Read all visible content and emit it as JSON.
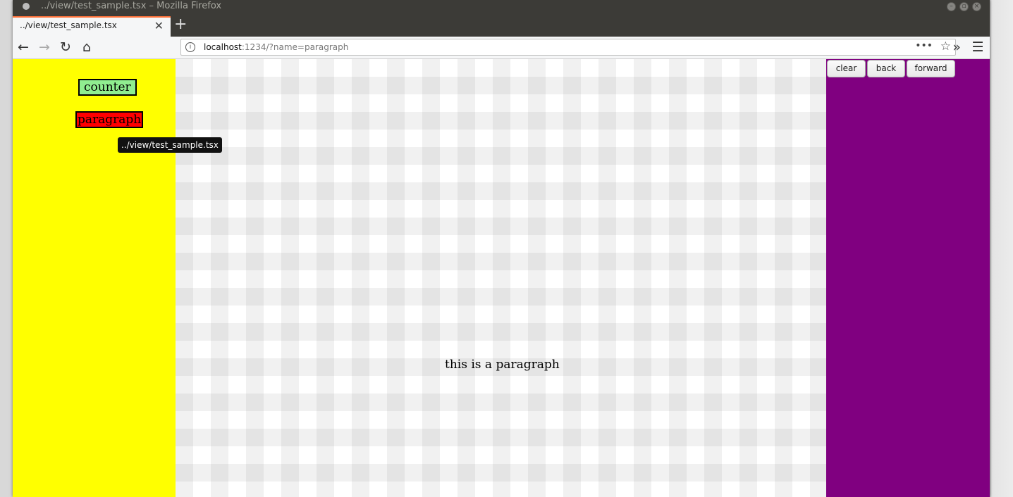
{
  "window": {
    "title": "../view/test_sample.tsx – Mozilla Firefox"
  },
  "tabs": [
    {
      "label": "../view/test_sample.tsx",
      "active": true
    }
  ],
  "nav": {
    "url_host": "localhost",
    "url_rest": ":1234/?name=paragraph"
  },
  "sidebar": {
    "items": [
      {
        "label": "counter",
        "color": "#90ee90"
      },
      {
        "label": "paragraph",
        "color": "#ff0000"
      }
    ],
    "background": "#ffff00"
  },
  "tooltip": {
    "text": "../view/test_sample.tsx"
  },
  "main": {
    "paragraph": "this is a paragraph"
  },
  "controls": {
    "clear": "clear",
    "back": "back",
    "forward": "forward",
    "background": "#800080"
  },
  "icons": {
    "back": "arrow-left-icon",
    "forward": "arrow-right-icon",
    "reload": "reload-icon",
    "home": "home-icon",
    "info": "info-icon",
    "page_actions": "more-dots-icon",
    "bookmark": "star-icon",
    "overflow": "double-chevron-icon",
    "menu": "hamburger-icon"
  }
}
